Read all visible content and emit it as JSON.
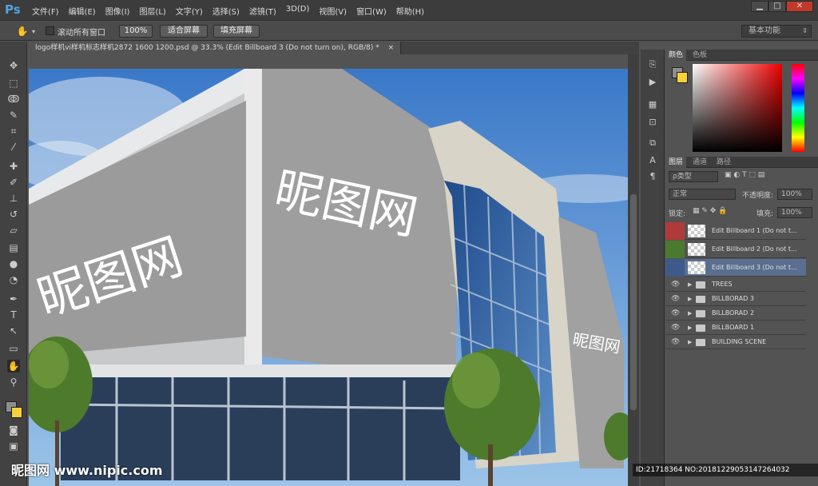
{
  "app": {
    "logo": "Ps"
  },
  "menu": [
    "文件(F)",
    "编辑(E)",
    "图像(I)",
    "图层(L)",
    "文字(Y)",
    "选择(S)",
    "滤镜(T)",
    "3D(D)",
    "视图(V)",
    "窗口(W)",
    "帮助(H)"
  ],
  "window_controls": {
    "minimize": "▁",
    "maximize": "□",
    "close": "✕"
  },
  "options_bar": {
    "scroll_all_label": "滚动所有窗口",
    "zoom_btn": "100%",
    "fit_btn": "适合屏幕",
    "fill_btn": "填充屏幕",
    "workspace": "基本功能"
  },
  "document_tab": {
    "title": "logo样机vi样机标志样机2872 1600 1200.psd @ 33.3% (Edit Billboard 3 (Do not turn on), RGB/8) *",
    "close": "×"
  },
  "canvas": {
    "billboard_text_1": "昵图网",
    "billboard_text_2": "昵图网",
    "billboard_text_3": "昵图网"
  },
  "color_panel": {
    "tabs": [
      "颜色",
      "色板"
    ],
    "fg_color": "#8e8e8e",
    "bg_color": "#f5d23a"
  },
  "layers_panel": {
    "tabs": [
      "图层",
      "通道",
      "路径"
    ],
    "filter_label": "ρ类型",
    "blend_mode": "正常",
    "opacity_label": "不透明度:",
    "opacity_value": "100%",
    "lock_label": "锁定:",
    "fill_label": "填充:",
    "fill_value": "100%",
    "layers": [
      {
        "name": "Edit Billboard 1 (Do not t...",
        "color": "#b03a3a",
        "type": "smart"
      },
      {
        "name": "Edit Billboard 2 (Do not t...",
        "color": "#4a7a2e",
        "type": "smart"
      },
      {
        "name": "Edit Billboard 3 (Do not t...",
        "color": "#3d5a8a",
        "type": "smart",
        "selected": true
      },
      {
        "name": "TREES",
        "type": "group"
      },
      {
        "name": "BILLBORAD 3",
        "type": "group"
      },
      {
        "name": "BILLBORAD 2",
        "type": "group"
      },
      {
        "name": "BILLBOARD 1",
        "type": "group"
      },
      {
        "name": "BUILDING SCENE",
        "type": "group"
      }
    ]
  },
  "watermark": {
    "logo": "昵图网 www.nipic.com",
    "id_text": "ID:21718364 NO:20181229053147264032"
  }
}
